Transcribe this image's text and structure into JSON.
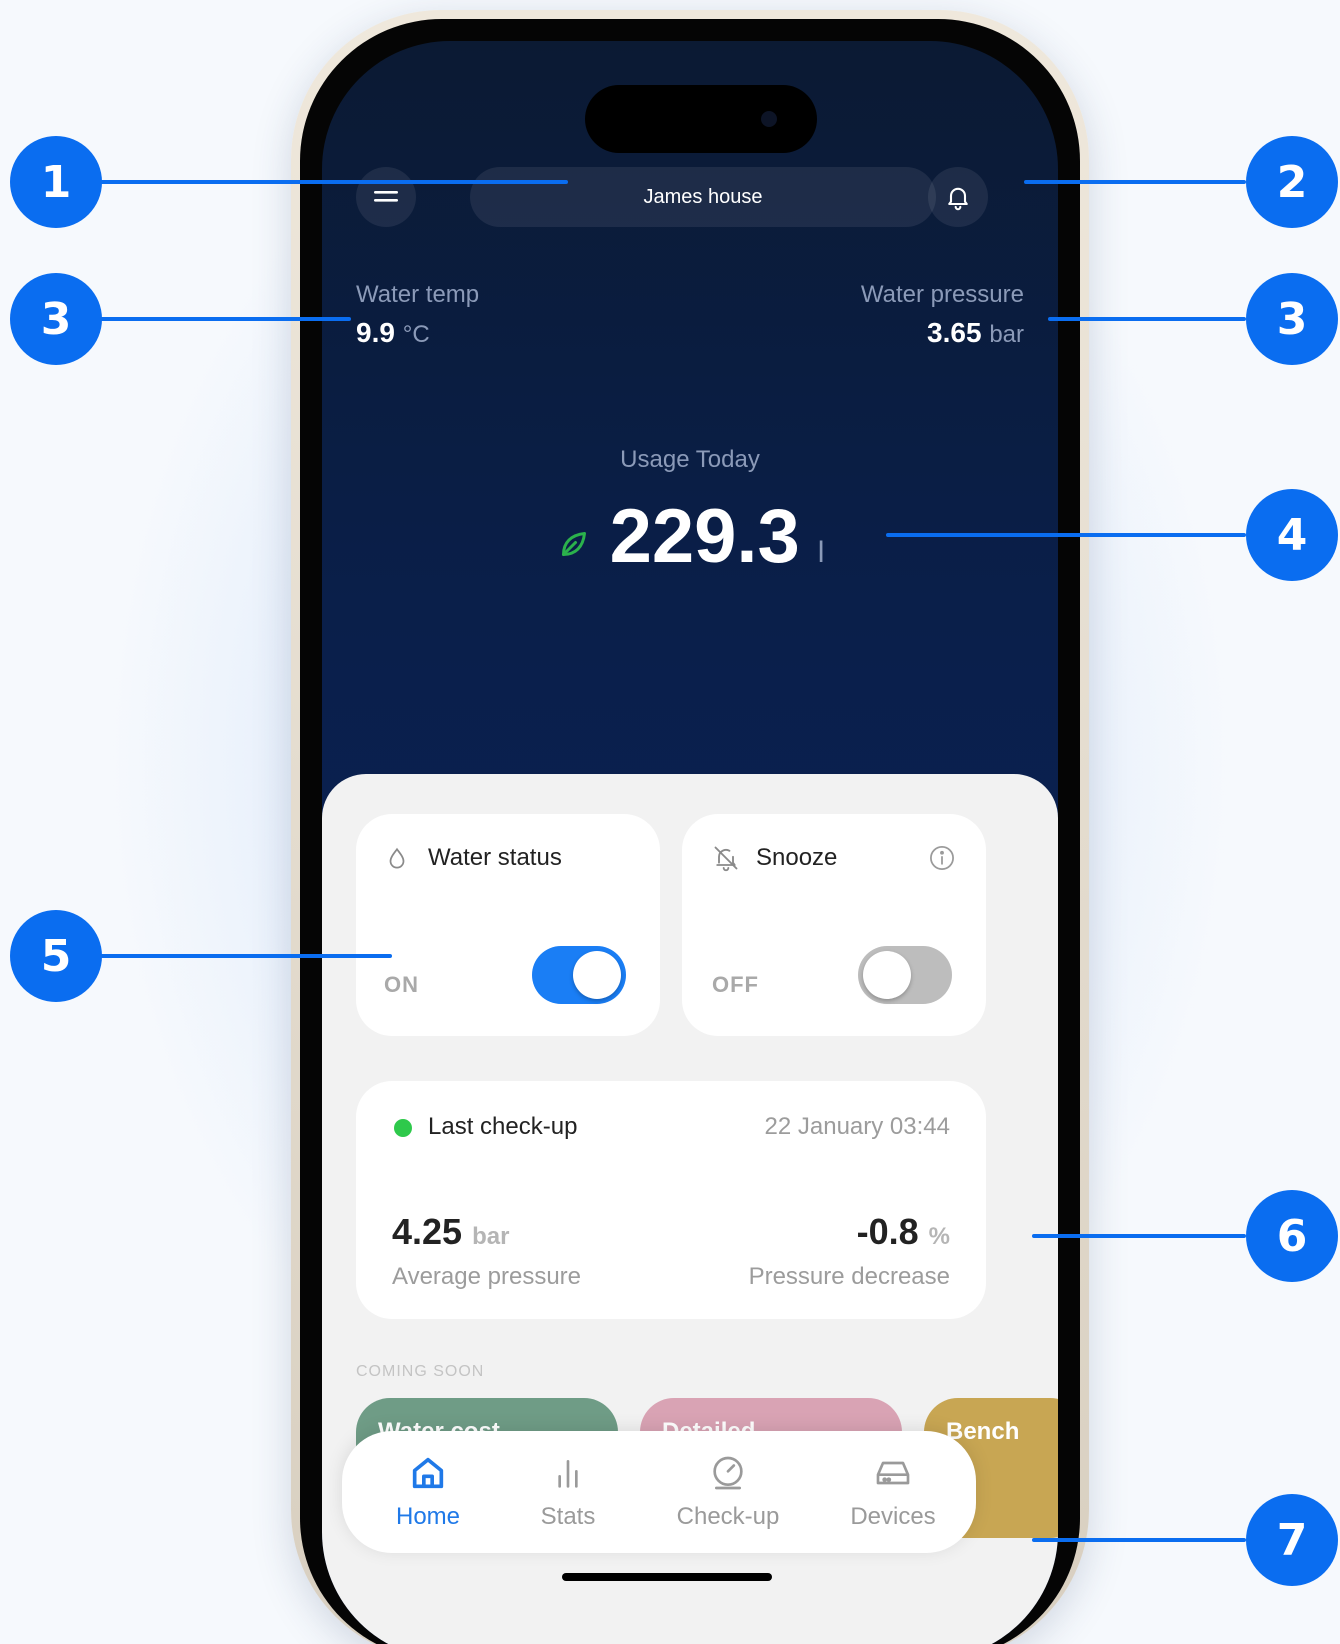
{
  "header": {
    "house_name": "James house"
  },
  "metrics": {
    "water_temp_label": "Water temp",
    "water_temp_value": "9.9",
    "water_temp_unit": "°C",
    "water_pressure_label": "Water pressure",
    "water_pressure_value": "3.65",
    "water_pressure_unit": "bar"
  },
  "usage": {
    "label": "Usage Today",
    "value": "229.3",
    "unit": "l"
  },
  "water_status": {
    "title": "Water status",
    "state": "ON",
    "enabled": true
  },
  "snooze": {
    "title": "Snooze",
    "state": "OFF",
    "enabled": false
  },
  "checkup": {
    "title": "Last check-up",
    "datetime": "22 January 03:44",
    "avg_pressure_value": "4.25",
    "avg_pressure_unit": "bar",
    "avg_pressure_label": "Average pressure",
    "decrease_value": "-0.8",
    "decrease_unit": "%",
    "decrease_label": "Pressure decrease"
  },
  "coming_soon": {
    "label": "COMING SOON",
    "cards": [
      "Water cost",
      "Detailed",
      "Bench"
    ]
  },
  "tabs": [
    {
      "label": "Home",
      "icon": "home-icon",
      "active": true
    },
    {
      "label": "Stats",
      "icon": "stats-icon",
      "active": false
    },
    {
      "label": "Check-up",
      "icon": "gauge-icon",
      "active": false
    },
    {
      "label": "Devices",
      "icon": "device-icon",
      "active": false
    }
  ],
  "callouts": [
    "1",
    "2",
    "3",
    "3",
    "4",
    "5",
    "6",
    "7"
  ],
  "colors": {
    "accent": "#0a6df0",
    "tab_active": "#1f79e8",
    "toggle_on": "#1a7ef5",
    "toggle_off": "#bdbdbd",
    "leaf": "#2bb24c",
    "status_dot": "#2ec94b"
  }
}
